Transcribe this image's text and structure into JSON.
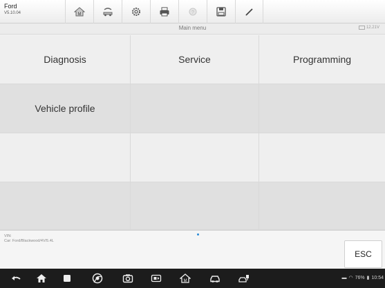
{
  "header": {
    "app_name": "Ford",
    "version": "V5.10.04"
  },
  "toolbar": {
    "icons": [
      "home-icon",
      "vehicle-swap-icon",
      "settings-icon",
      "print-icon",
      "help-icon",
      "save-icon",
      "pen-icon"
    ]
  },
  "titlebar": {
    "title": "Main menu",
    "voltage": "12.21V"
  },
  "menu": {
    "items": [
      "Diagnosis",
      "Service",
      "Programming",
      "Vehicle profile",
      "",
      "",
      "",
      "",
      "",
      "",
      "",
      ""
    ]
  },
  "info": {
    "vin_label": "VIN:",
    "car": "Car: Ford/Blackwood/4V/5.4L"
  },
  "esc_label": "ESC",
  "status": {
    "battery": "76%",
    "time": "10:54"
  }
}
